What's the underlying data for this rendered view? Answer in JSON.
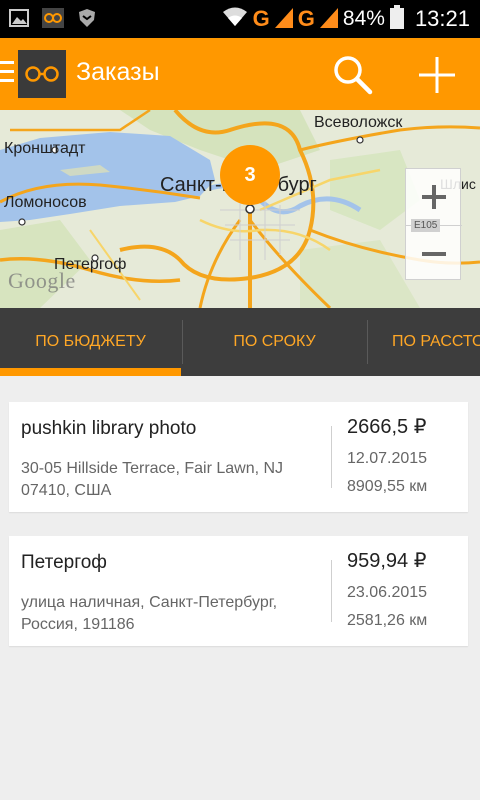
{
  "status_bar": {
    "battery": "84%",
    "time": "13:21",
    "network_1": "G",
    "network_2": "G"
  },
  "app_bar": {
    "title": "Заказы",
    "accent": "#ff9800",
    "icons": [
      "menu-icon",
      "app-logo-icon",
      "search-icon",
      "add-icon"
    ]
  },
  "map": {
    "cluster_count": "3",
    "labels": {
      "kronshtadt": "Кронштадт",
      "lomonosov": "Ломоносов",
      "petergof": "Петергоф",
      "spb": "Санкт-Петербург",
      "vsevolozhsk": "Всеволожск",
      "shlis": "Шлис"
    },
    "road_shield": "E105",
    "attribution": "Google",
    "zoom_in": "+",
    "zoom_out": "−"
  },
  "tabs": [
    {
      "label": "ПО БЮДЖЕТУ",
      "active": true
    },
    {
      "label": "ПО СРОКУ",
      "active": false
    },
    {
      "label": "ПО РАССТОЯНИЮ",
      "active": false
    }
  ],
  "orders": [
    {
      "title": "pushkin library photo",
      "address": "30-05 Hillside Terrace, Fair Lawn, NJ 07410, США",
      "price": "2666,5 ₽",
      "date": "12.07.2015",
      "distance": "8909,55 км"
    },
    {
      "title": "Петергоф",
      "address": "улица наличная, Санкт-Петербург, Россия, 191186",
      "price": "959,94 ₽",
      "date": "23.06.2015",
      "distance": "2581,26 км"
    }
  ]
}
